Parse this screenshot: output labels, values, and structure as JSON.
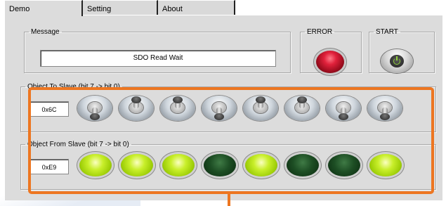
{
  "tabs": [
    {
      "label": "Demo",
      "active": true
    },
    {
      "label": "Setting",
      "active": false
    },
    {
      "label": "About",
      "active": false
    }
  ],
  "message": {
    "legend": "Message",
    "text": "SDO Read Wait"
  },
  "error": {
    "legend": "ERROR",
    "color": "#c8102e"
  },
  "start": {
    "legend": "START"
  },
  "to_slave": {
    "legend": "Object To Slave (bit 7 -> bit 0)",
    "value": "0x6C",
    "switches": [
      "down",
      "up",
      "up",
      "down",
      "up",
      "up",
      "down",
      "down"
    ]
  },
  "from_slave": {
    "legend": "Object From Slave (bit 7 -> bit 0)",
    "value": "0xE9",
    "leds": [
      "on",
      "on",
      "on",
      "off",
      "on",
      "off",
      "off",
      "on"
    ]
  },
  "colors": {
    "highlight": "#ed7621",
    "led_on": "#b5e21a",
    "led_off": "#1d4e24"
  }
}
